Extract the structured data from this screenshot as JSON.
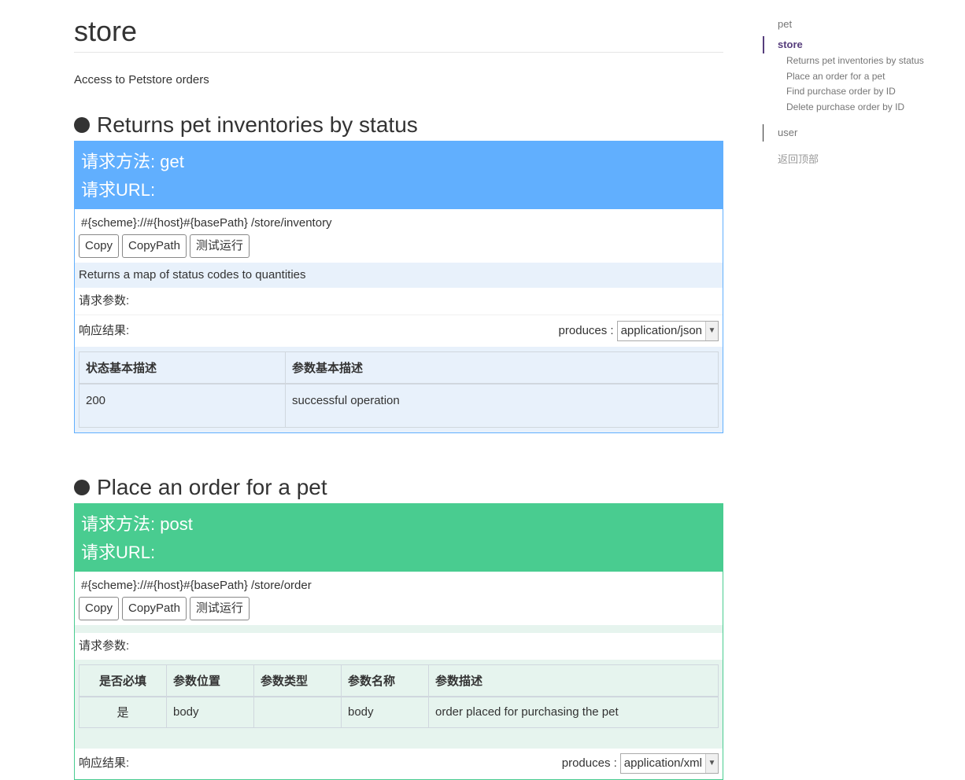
{
  "page": {
    "title": "store",
    "description": "Access to Petstore orders"
  },
  "sidebar": {
    "items": [
      {
        "label": "pet"
      },
      {
        "label": "store"
      },
      {
        "label": "user"
      }
    ],
    "sub_items": [
      "Returns pet inventories by status",
      "Place an order for a pet",
      "Find purchase order by ID",
      "Delete purchase order by ID"
    ],
    "back_to_top": "返回顶部"
  },
  "ops": [
    {
      "title": "Returns pet inventories by status",
      "method_line": "请求方法: get",
      "url_label": "请求URL:",
      "url": "#{scheme}://#{host}#{basePath} /store/inventory",
      "buttons": [
        "Copy",
        "CopyPath",
        "测试运行"
      ],
      "summary": "Returns a map of status codes to quantities",
      "params_label": "请求参数:",
      "response_label": "响应结果:",
      "produces_label": "produces :",
      "produces_value": "application/json",
      "response_table": {
        "headers": [
          "状态基本描述",
          "参数基本描述"
        ],
        "rows": [
          [
            "200",
            "successful operation"
          ]
        ]
      },
      "color": "#61affe"
    },
    {
      "title": "Place an order for a pet",
      "method_line": "请求方法: post",
      "url_label": "请求URL:",
      "url": "#{scheme}://#{host}#{basePath} /store/order",
      "buttons": [
        "Copy",
        "CopyPath",
        "测试运行"
      ],
      "params_label": "请求参数:",
      "params_table": {
        "headers": [
          "是否必填",
          "参数位置",
          "参数类型",
          "参数名称",
          "参数描述"
        ],
        "rows": [
          [
            "是",
            "body",
            "",
            "body",
            "order placed for purchasing the pet"
          ]
        ]
      },
      "response_label": "响应结果:",
      "produces_label": "produces :",
      "produces_value": "application/xml",
      "color": "#49cc90"
    }
  ]
}
